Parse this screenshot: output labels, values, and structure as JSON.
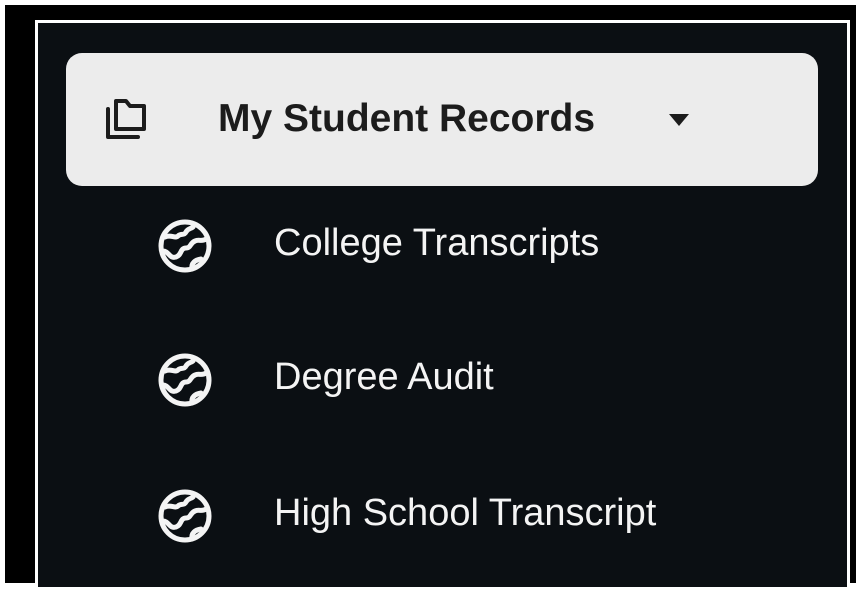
{
  "menu": {
    "header": {
      "label": "My Student Records",
      "icon": "folders-icon",
      "caret": "caret-down-icon"
    },
    "items": [
      {
        "label": "College Transcripts",
        "icon": "globe-icon"
      },
      {
        "label": "Degree Audit",
        "icon": "globe-icon"
      },
      {
        "label": "High School Transcript",
        "icon": "globe-icon"
      }
    ]
  },
  "colors": {
    "background": "#0b0f13",
    "header_background": "#ececec",
    "header_text": "#1c1c1c",
    "item_text": "#f4f4f4",
    "border": "#ffffff"
  }
}
